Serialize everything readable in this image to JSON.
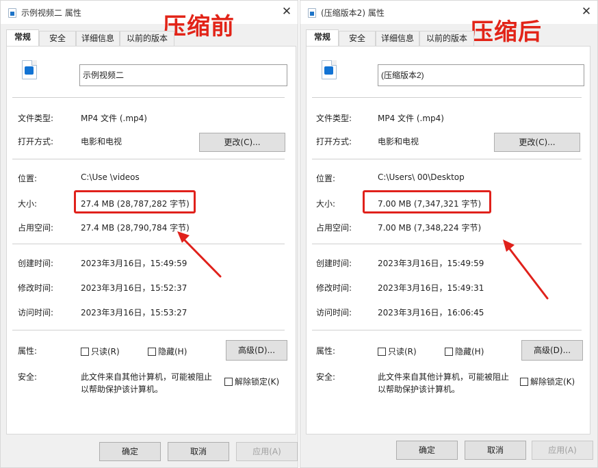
{
  "left": {
    "title": "示例视频二 属性",
    "compare_tag": "压缩前",
    "tabs": [
      "常规",
      "安全",
      "详细信息",
      "以前的版本"
    ],
    "file_name": "示例视频二",
    "rows": {
      "type_label": "文件类型:",
      "type_value": "MP4 文件 (.mp4)",
      "open_label": "打开方式:",
      "open_value": "电影和电视",
      "change_button": "更改(C)...",
      "location_label": "位置:",
      "location_value": "C:\\Use            \\videos",
      "size_label": "大小:",
      "size_value": "27.4 MB (28,787,282 字节)",
      "disk_label": "占用空间:",
      "disk_value": "27.4 MB (28,790,784 字节)",
      "created_label": "创建时间:",
      "created_value": "2023年3月16日，15:49:59",
      "modified_label": "修改时间:",
      "modified_value": "2023年3月16日，15:52:37",
      "accessed_label": "访问时间:",
      "accessed_value": "2023年3月16日，15:53:27",
      "attr_label": "属性:",
      "readonly": "只读(R)",
      "hidden": "隐藏(H)",
      "advanced_button": "高级(D)...",
      "security_label": "安全:",
      "security_line1": "此文件来自其他计算机，可能被阻止",
      "security_line2": "以帮助保护该计算机。",
      "unblock": "解除锁定(K)"
    },
    "footer": {
      "ok": "确定",
      "cancel": "取消",
      "apply": "应用(A)"
    }
  },
  "right": {
    "title": "(压缩版本2) 属性",
    "compare_tag": "压缩后",
    "tabs": [
      "常规",
      "安全",
      "详细信息",
      "以前的版本"
    ],
    "file_name": "(压缩版本2)",
    "rows": {
      "type_label": "文件类型:",
      "type_value": "MP4 文件 (.mp4)",
      "open_label": "打开方式:",
      "open_value": "电影和电视",
      "change_button": "更改(C)...",
      "location_label": "位置:",
      "location_value": "C:\\Users\\     00\\Desktop",
      "size_label": "大小:",
      "size_value": "7.00 MB (7,347,321 字节)",
      "disk_label": "占用空间:",
      "disk_value": "7.00 MB (7,348,224 字节)",
      "created_label": "创建时间:",
      "created_value": "2023年3月16日，15:49:59",
      "modified_label": "修改时间:",
      "modified_value": "2023年3月16日，15:49:31",
      "accessed_label": "访问时间:",
      "accessed_value": "2023年3月16日，16:06:45",
      "attr_label": "属性:",
      "readonly": "只读(R)",
      "hidden": "隐藏(H)",
      "advanced_button": "高级(D)...",
      "security_label": "安全:",
      "security_line1": "此文件来自其他计算机，可能被阻止",
      "security_line2": "以帮助保护该计算机。",
      "unblock": "解除锁定(K)"
    },
    "footer": {
      "ok": "确定",
      "cancel": "取消",
      "apply": "应用(A)"
    }
  },
  "colors": {
    "highlight": "#e0211b",
    "tag_red": "#e22418",
    "file_icon": "#1173d4"
  },
  "icons": {
    "file": "video-file-icon",
    "close": "close-icon",
    "arrow": "red-arrow-icon"
  }
}
